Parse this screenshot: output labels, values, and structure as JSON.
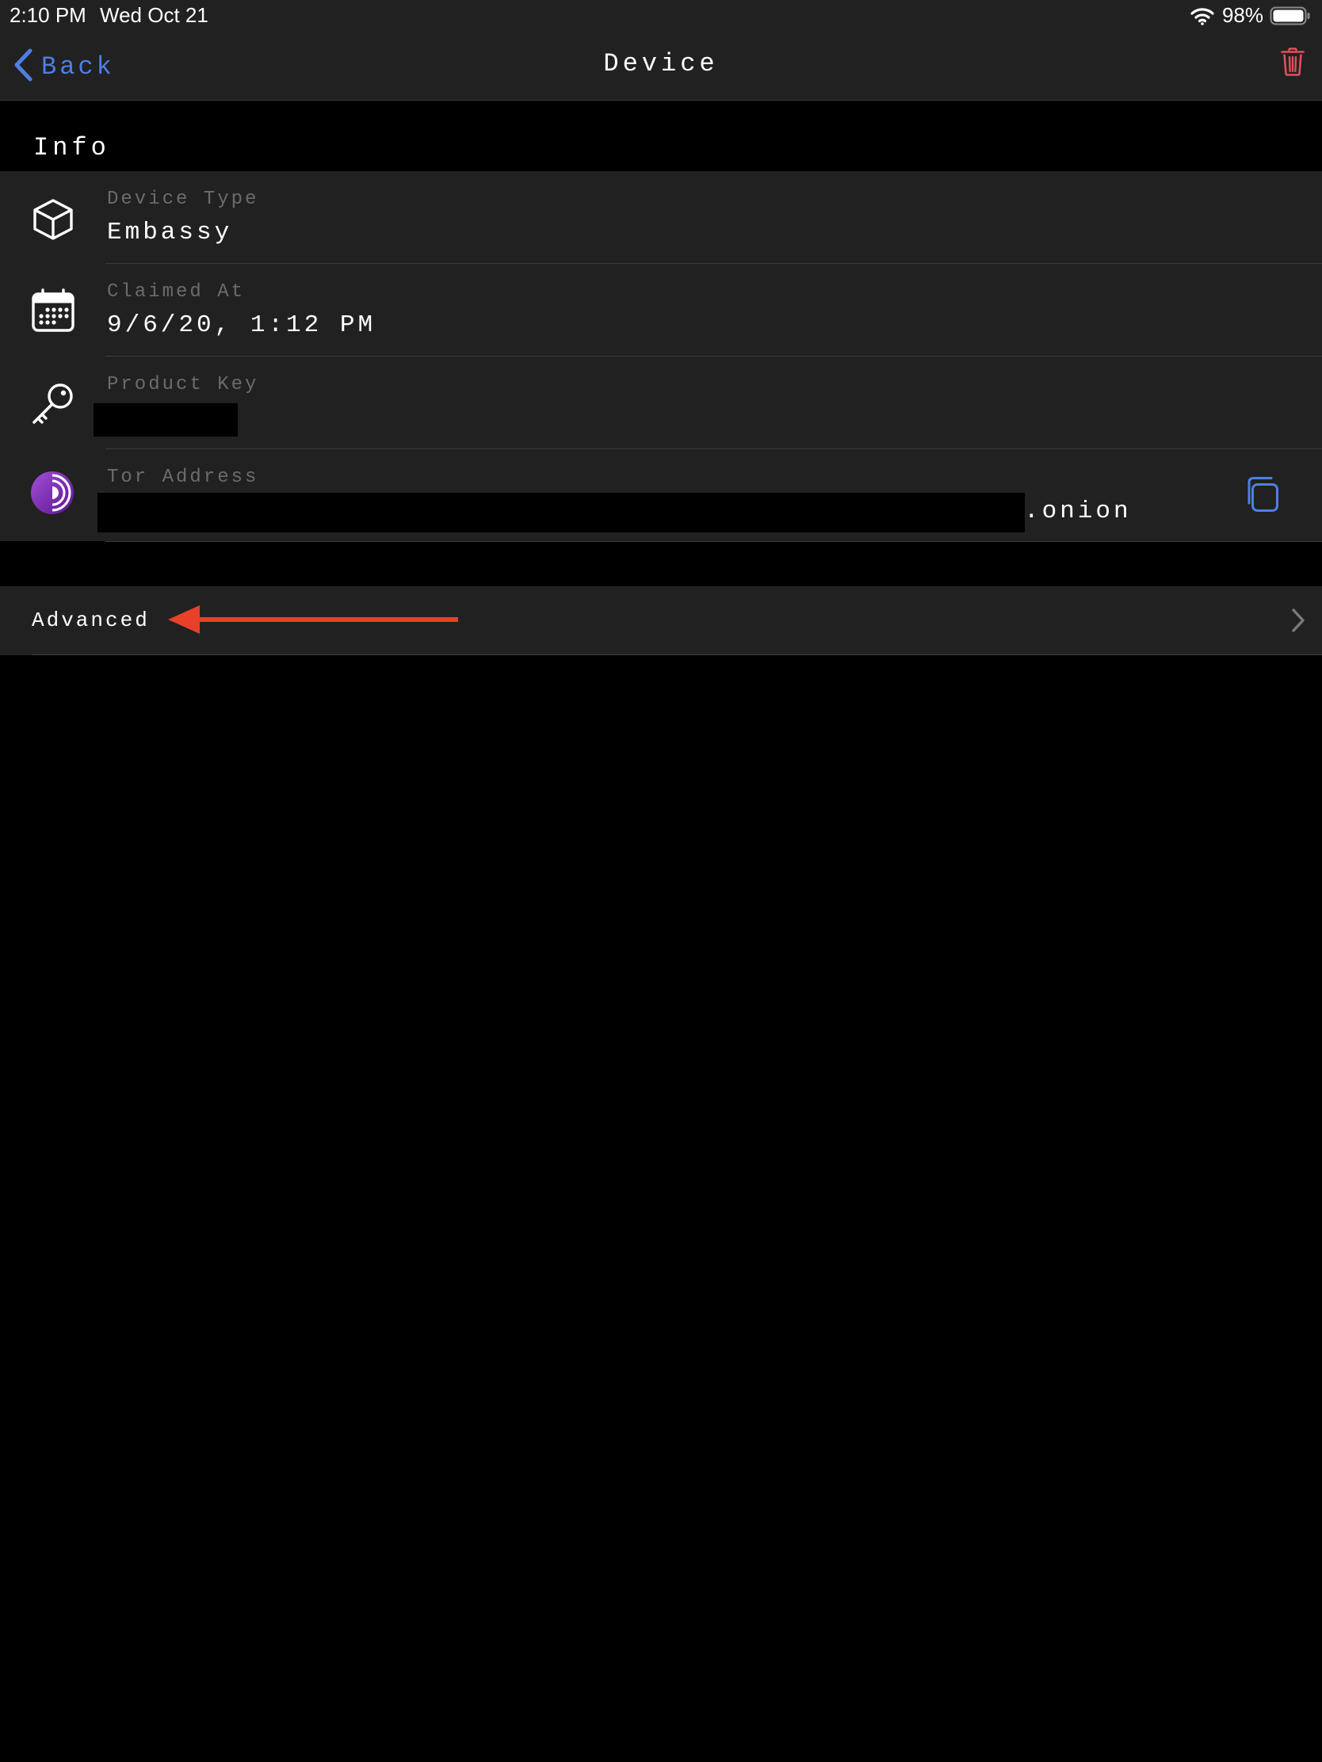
{
  "status_bar": {
    "time": "2:10 PM",
    "date": "Wed Oct 21",
    "battery": "98%",
    "icons": [
      "wifi-icon",
      "battery-icon"
    ]
  },
  "nav": {
    "back_label": "Back",
    "title": "Device",
    "icons": [
      "chevron-left-icon",
      "trash-icon"
    ]
  },
  "info": {
    "section_title": "Info",
    "rows": [
      {
        "label": "Device Type",
        "value": "Embassy",
        "icon": "cube-icon"
      },
      {
        "label": "Claimed At",
        "value": "9/6/20, 1:12 PM",
        "icon": "calendar-icon"
      },
      {
        "label": "Product Key",
        "value": "",
        "icon": "key-icon",
        "redacted": true
      },
      {
        "label": "Tor Address",
        "value_suffix": ".onion",
        "icon": "tor-icon",
        "redacted": true,
        "action_icon": "copy-icon"
      }
    ]
  },
  "advanced": {
    "label": "Advanced",
    "icon": "chevron-right-icon",
    "annotation": "red arrow pointing to Advanced"
  },
  "colors": {
    "accent": "#4f7ee8",
    "destructive": "#e0505a",
    "annotation": "#e8402a",
    "tor_purple": "#7d2fb0",
    "row_background": "#212121",
    "background": "#000000"
  }
}
